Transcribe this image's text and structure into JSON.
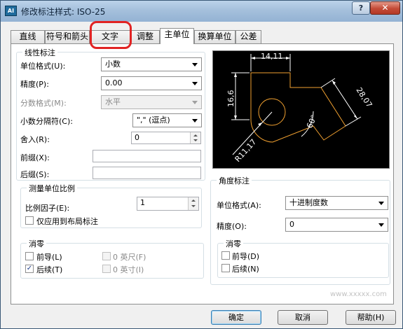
{
  "window": {
    "title": "修改标注样式: ISO-25",
    "help_glyph": "?",
    "close_glyph": "✕",
    "app_icon_text": "AI"
  },
  "tabs": [
    {
      "label": "直线"
    },
    {
      "label": "符号和箭头"
    },
    {
      "label": "文字"
    },
    {
      "label": "调整"
    },
    {
      "label": "主单位"
    },
    {
      "label": "换算单位"
    },
    {
      "label": "公差"
    }
  ],
  "active_tab": "主单位",
  "linear": {
    "group_title": "线性标注",
    "unit_format": {
      "label": "单位格式(U):",
      "value": "小数"
    },
    "precision": {
      "label": "精度(P):",
      "value": "0.00"
    },
    "fraction_format": {
      "label": "分数格式(M):",
      "value": "水平"
    },
    "decimal_separator": {
      "label": "小数分隔符(C):",
      "value": "\",\"  (逗点)"
    },
    "round_off": {
      "label": "舍入(R):",
      "value": "0"
    },
    "prefix": {
      "label": "前缀(X):",
      "value": ""
    },
    "suffix": {
      "label": "后缀(S):",
      "value": ""
    }
  },
  "measurement_scale": {
    "group_title": "测量单位比例",
    "scale_factor": {
      "label": "比例因子(E):",
      "value": "1"
    },
    "layout_only": {
      "label": "仅应用到布局标注",
      "checked": false
    }
  },
  "zero_suppression_linear": {
    "group_title": "消零",
    "leading": {
      "label": "前导(L)",
      "checked": false
    },
    "trailing": {
      "label": "后续(T)",
      "checked": true
    },
    "feet": {
      "label": "0 英尺(F)",
      "checked": false
    },
    "inches": {
      "label": "0 英寸(I)",
      "checked": false
    }
  },
  "preview": {
    "dim_top": "14,11",
    "dim_left": "16,6",
    "dim_diag": "28,07",
    "dim_angle": "60°",
    "dim_radius": "R11,17",
    "colors": {
      "bg": "#000000",
      "geometry": "#f0a030",
      "dims": "#ffffff"
    }
  },
  "angular": {
    "group_title": "角度标注",
    "unit_format": {
      "label": "单位格式(A):",
      "value": "十进制度数"
    },
    "precision": {
      "label": "精度(O):",
      "value": "0"
    }
  },
  "zero_suppression_angular": {
    "group_title": "消零",
    "leading": {
      "label": "前导(D)",
      "checked": false
    },
    "trailing": {
      "label": "后续(N)",
      "checked": false
    }
  },
  "buttons": {
    "ok": "确定",
    "cancel": "取消",
    "help": "帮助(H)"
  },
  "watermark": "www.xxxxx.com"
}
